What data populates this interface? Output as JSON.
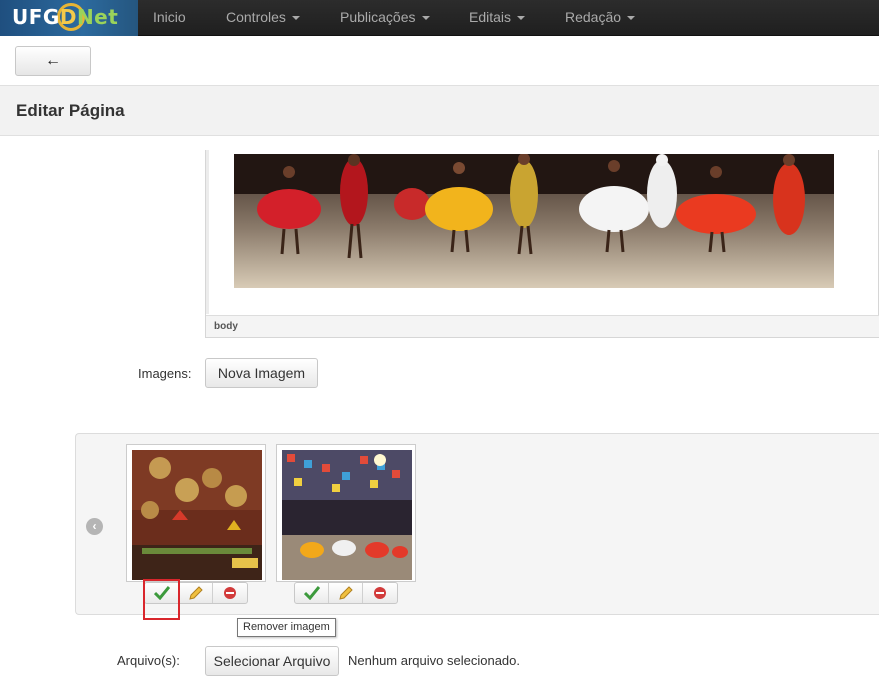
{
  "brand": {
    "name_a": "UFG",
    "name_b": "D",
    "name_c": "Net"
  },
  "nav": {
    "items": [
      {
        "label": "Inicio",
        "has_caret": false
      },
      {
        "label": "Controles",
        "has_caret": true
      },
      {
        "label": "Publicações",
        "has_caret": true
      },
      {
        "label": "Editais",
        "has_caret": true
      },
      {
        "label": "Redação",
        "has_caret": true
      }
    ]
  },
  "toolbar": {
    "back_icon": "arrow-left-icon"
  },
  "header": {
    "title": "Editar Página"
  },
  "editor": {
    "status_path": "body"
  },
  "images": {
    "label": "Imagens:",
    "new_button": "Nova Imagem",
    "prev_icon": "chevron-left-icon",
    "thumbnails": [
      {
        "actions": [
          "check-icon",
          "pencil-icon",
          "minus-circle-icon"
        ]
      },
      {
        "actions": [
          "check-icon",
          "pencil-icon",
          "minus-circle-icon"
        ]
      }
    ],
    "tooltip": "Remover imagem"
  },
  "file": {
    "label": "Arquivo(s):",
    "button": "Selecionar Arquivo",
    "status": "Nenhum arquivo selecionado."
  },
  "colors": {
    "nav_bg": "#222222",
    "highlight": "#d9262c",
    "check": "#3c9a3c",
    "remove": "#d23b3b"
  }
}
